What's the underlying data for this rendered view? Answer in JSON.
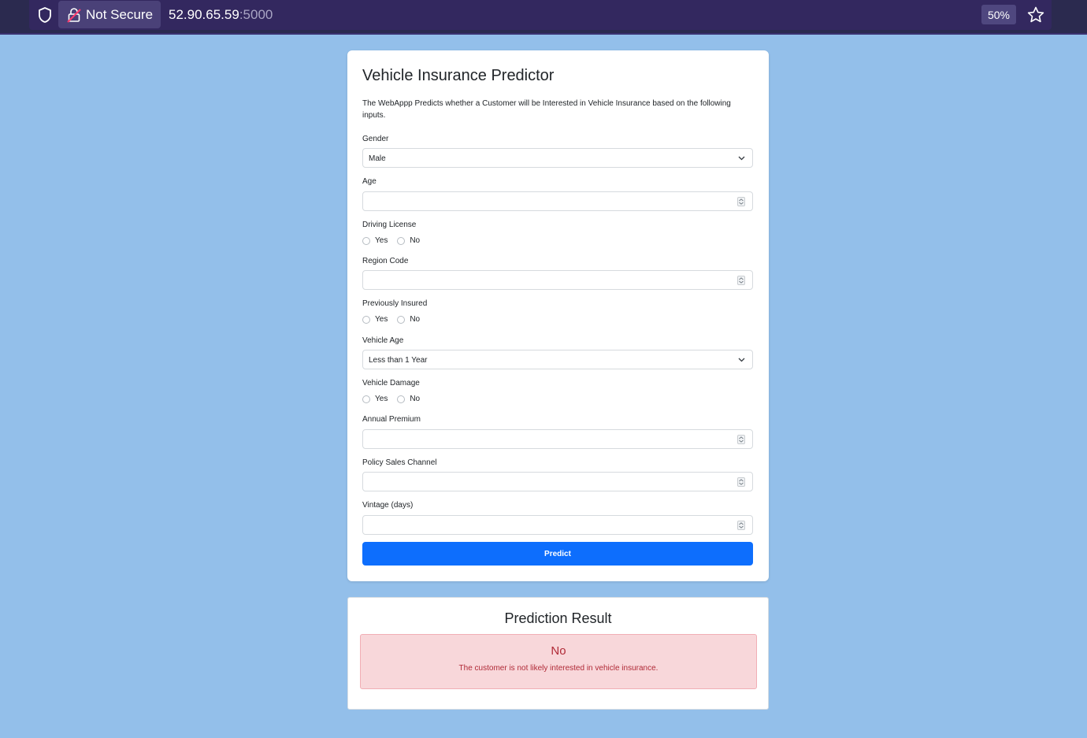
{
  "browser": {
    "security_label": "Not Secure",
    "url_host": "52.90.65.59",
    "url_port": ":5000",
    "zoom": "50%"
  },
  "form": {
    "title": "Vehicle Insurance Predictor",
    "description": "The WebAppp Predicts whether a Customer will be Interested in Vehicle Insurance based on the following inputs.",
    "gender": {
      "label": "Gender",
      "value": "Male"
    },
    "age": {
      "label": "Age",
      "value": ""
    },
    "driving_license": {
      "label": "Driving License",
      "options": [
        "Yes",
        "No"
      ]
    },
    "region_code": {
      "label": "Region Code",
      "value": ""
    },
    "previously_insured": {
      "label": "Previously Insured",
      "options": [
        "Yes",
        "No"
      ]
    },
    "vehicle_age": {
      "label": "Vehicle Age",
      "value": "Less than 1 Year"
    },
    "vehicle_damage": {
      "label": "Vehicle Damage",
      "options": [
        "Yes",
        "No"
      ]
    },
    "annual_premium": {
      "label": "Annual Premium",
      "value": ""
    },
    "policy_sales_channel": {
      "label": "Policy Sales Channel",
      "value": ""
    },
    "vintage": {
      "label": "Vintage (days)",
      "value": ""
    },
    "submit_label": "Predict"
  },
  "result": {
    "title": "Prediction Result",
    "answer": "No",
    "message": "The customer is not likely interested in vehicle insurance."
  }
}
